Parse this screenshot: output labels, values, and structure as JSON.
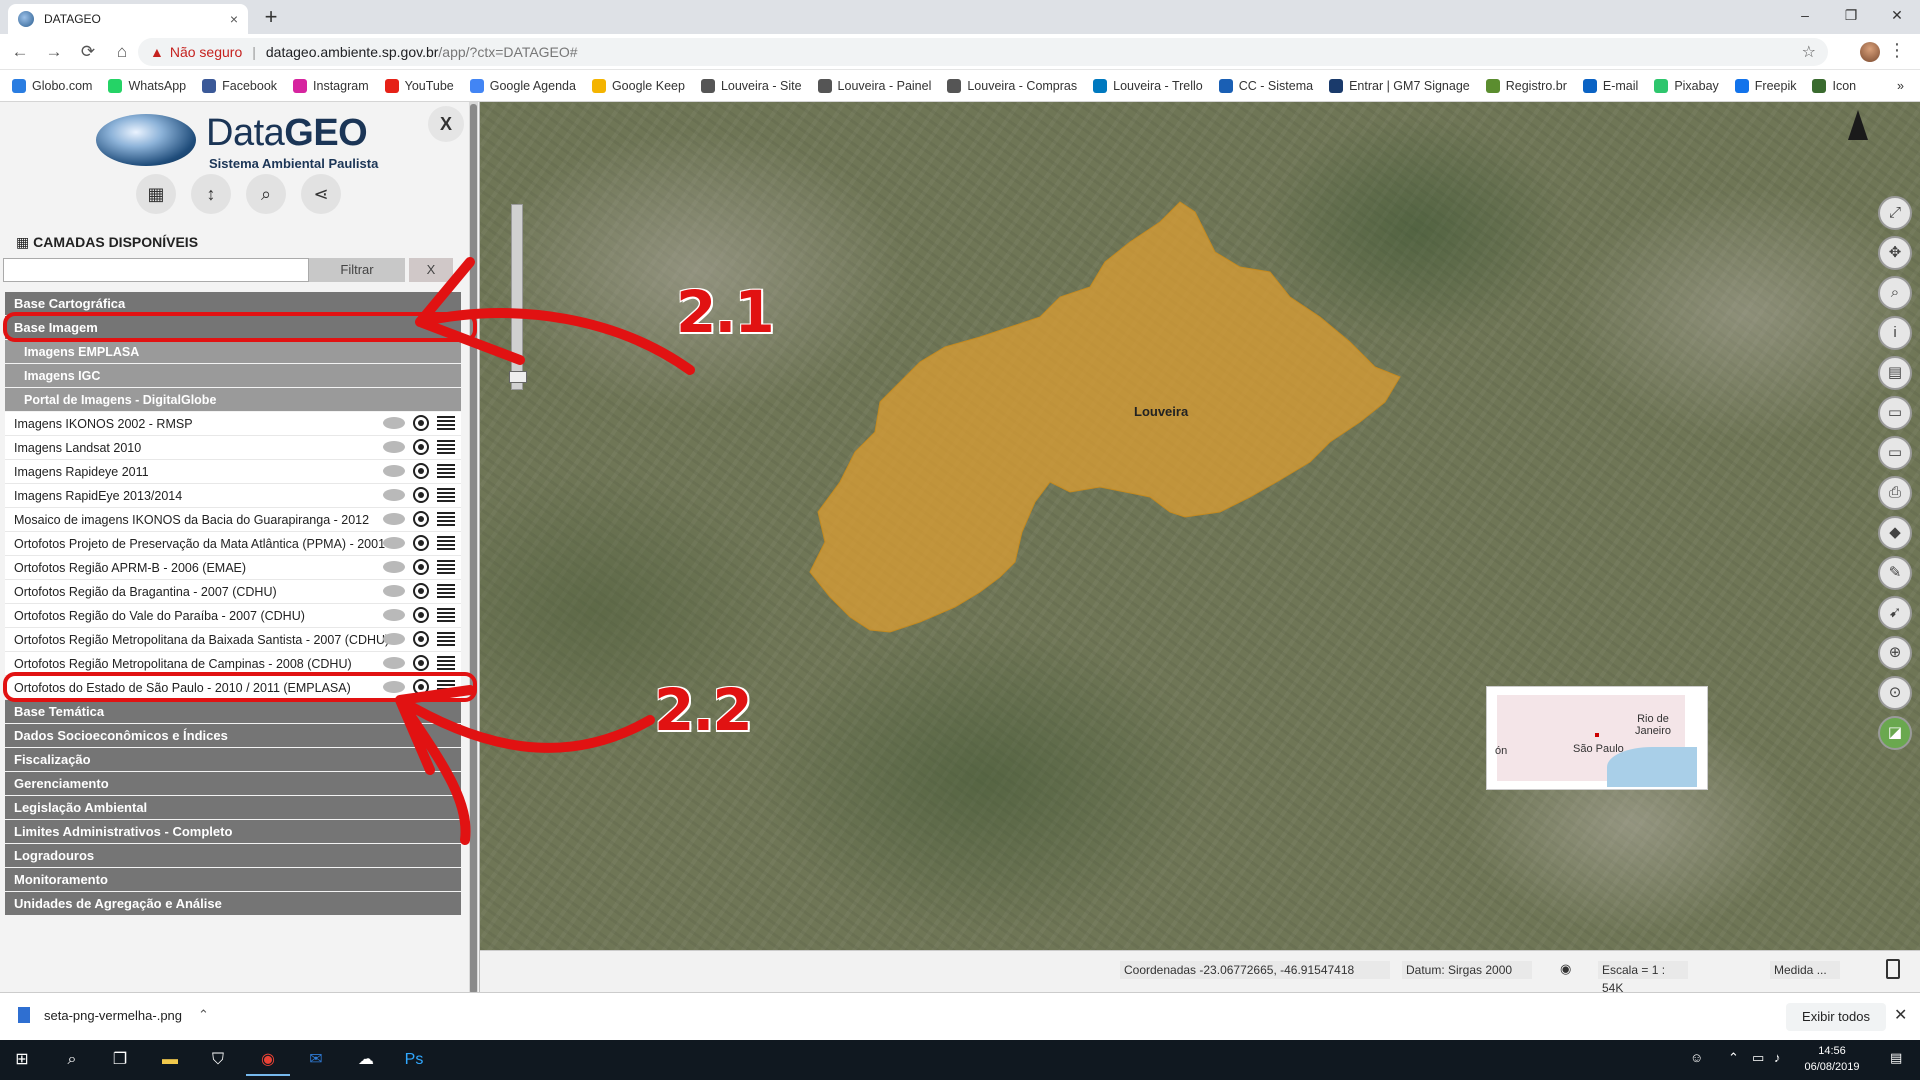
{
  "browser": {
    "tab_title": "DATAGEO",
    "tab_close": "×",
    "new_tab": "+",
    "window_buttons": [
      "–",
      "❐",
      "✕"
    ],
    "nav": [
      "←",
      "→",
      "⟳",
      "⌂"
    ],
    "security_label": "Não seguro",
    "url_host": "datageo.ambiente.sp.gov.br",
    "url_path": "/app/?ctx=DATAGEO#",
    "bookmarks": [
      {
        "label": "Globo.com",
        "color": "#2a7de1"
      },
      {
        "label": "WhatsApp",
        "color": "#25d366"
      },
      {
        "label": "Facebook",
        "color": "#3b5998"
      },
      {
        "label": "Instagram",
        "color": "#d6249f"
      },
      {
        "label": "YouTube",
        "color": "#e62117"
      },
      {
        "label": "Google Agenda",
        "color": "#4285f4"
      },
      {
        "label": "Google Keep",
        "color": "#f4b400"
      },
      {
        "label": "Louveira - Site",
        "color": "#555555"
      },
      {
        "label": "Louveira - Painel",
        "color": "#555555"
      },
      {
        "label": "Louveira - Compras",
        "color": "#555555"
      },
      {
        "label": "Louveira - Trello",
        "color": "#0079bf"
      },
      {
        "label": "CC - Sistema",
        "color": "#1a5fb4"
      },
      {
        "label": "Entrar | GM7 Signage",
        "color": "#1a3a6b"
      },
      {
        "label": "Registro.br",
        "color": "#5b8d2f"
      },
      {
        "label": "E-mail",
        "color": "#0b63c4"
      },
      {
        "label": "Pixabay",
        "color": "#2ec66d"
      },
      {
        "label": "Freepik",
        "color": "#1273eb"
      },
      {
        "label": "Icon",
        "color": "#3a6b2f"
      }
    ],
    "bookmarks_more": "»"
  },
  "panel": {
    "brand_light": "Data",
    "brand_bold": "GEO",
    "subtitle": "Sistema Ambiental Paulista",
    "close_label": "X",
    "tool_icons": [
      "grid-icon",
      "arrows-vertical-icon",
      "search-icon",
      "share-icon"
    ],
    "section_title": "CAMADAS DISPONÍVEIS",
    "filter": {
      "value": "",
      "button": "Filtrar",
      "clear": "X"
    },
    "layers": [
      {
        "type": "cat",
        "label": "Base Cartográfica"
      },
      {
        "type": "cat",
        "label": "Base Imagem"
      },
      {
        "type": "sub",
        "label": "Imagens EMPLASA"
      },
      {
        "type": "sub",
        "label": "Imagens IGC"
      },
      {
        "type": "sub",
        "label": "Portal de Imagens - DigitalGlobe"
      },
      {
        "type": "item",
        "label": "Imagens IKONOS 2002 - RMSP"
      },
      {
        "type": "item",
        "label": "Imagens Landsat 2010"
      },
      {
        "type": "item",
        "label": "Imagens Rapideye 2011"
      },
      {
        "type": "item",
        "label": "Imagens RapidEye 2013/2014"
      },
      {
        "type": "item",
        "label": "Mosaico de imagens IKONOS da Bacia do Guarapiranga - 2012"
      },
      {
        "type": "item",
        "label": "Ortofotos Projeto de Preservação da Mata Atlântica (PPMA) - 2001"
      },
      {
        "type": "item",
        "label": "Ortofotos Região APRM-B - 2006 (EMAE)"
      },
      {
        "type": "item",
        "label": "Ortofotos Região da Bragantina - 2007 (CDHU)"
      },
      {
        "type": "item",
        "label": "Ortofotos Região do Vale do Paraíba - 2007 (CDHU)"
      },
      {
        "type": "item",
        "label": "Ortofotos Região Metropolitana da Baixada Santista - 2007 (CDHU)"
      },
      {
        "type": "item",
        "label": "Ortofotos Região Metropolitana de Campinas - 2008 (CDHU)"
      },
      {
        "type": "item",
        "label": "Ortofotos do Estado de São Paulo - 2010 / 2011 (EMPLASA)"
      },
      {
        "type": "cat",
        "label": "Base Temática"
      },
      {
        "type": "cat",
        "label": "Dados Socioeconômicos e Índices"
      },
      {
        "type": "cat",
        "label": "Fiscalização"
      },
      {
        "type": "cat",
        "label": "Gerenciamento"
      },
      {
        "type": "cat",
        "label": "Legislação Ambiental"
      },
      {
        "type": "cat",
        "label": "Limites Administrativos - Completo"
      },
      {
        "type": "cat",
        "label": "Logradouros"
      },
      {
        "type": "cat",
        "label": "Monitoramento"
      },
      {
        "type": "cat",
        "label": "Unidades de Agregação e Análise"
      }
    ]
  },
  "map": {
    "place_label": "Louveira",
    "highlight_color": "#e0a030",
    "tool_icons": [
      "fullscreen-icon",
      "pan-icon",
      "zoom-icon",
      "info-icon",
      "document-icon",
      "ruler-icon",
      "ruler2-icon",
      "print-icon",
      "layers-icon",
      "pencil-icon",
      "pointer-icon",
      "zoom-in-icon",
      "locate-icon",
      "streetview-icon"
    ],
    "minimap": {
      "label1": "Rio de Janeiro",
      "label2": "São Paulo",
      "label3": "ón"
    }
  },
  "status": {
    "coords": "Coordenadas -23.06772665, -46.91547418",
    "datum": "Datum: Sirgas 2000",
    "scale": "Escala = 1 : 54K",
    "measure": "Medida ..."
  },
  "annotations": {
    "label1": "2.1",
    "label2": "2.2",
    "color": "#e11212"
  },
  "shelf": {
    "file": "seta-png-vermelha-.png",
    "show_all": "Exibir todos",
    "close": "✕"
  },
  "taskbar": {
    "time": "14:56",
    "date": "06/08/2019"
  }
}
